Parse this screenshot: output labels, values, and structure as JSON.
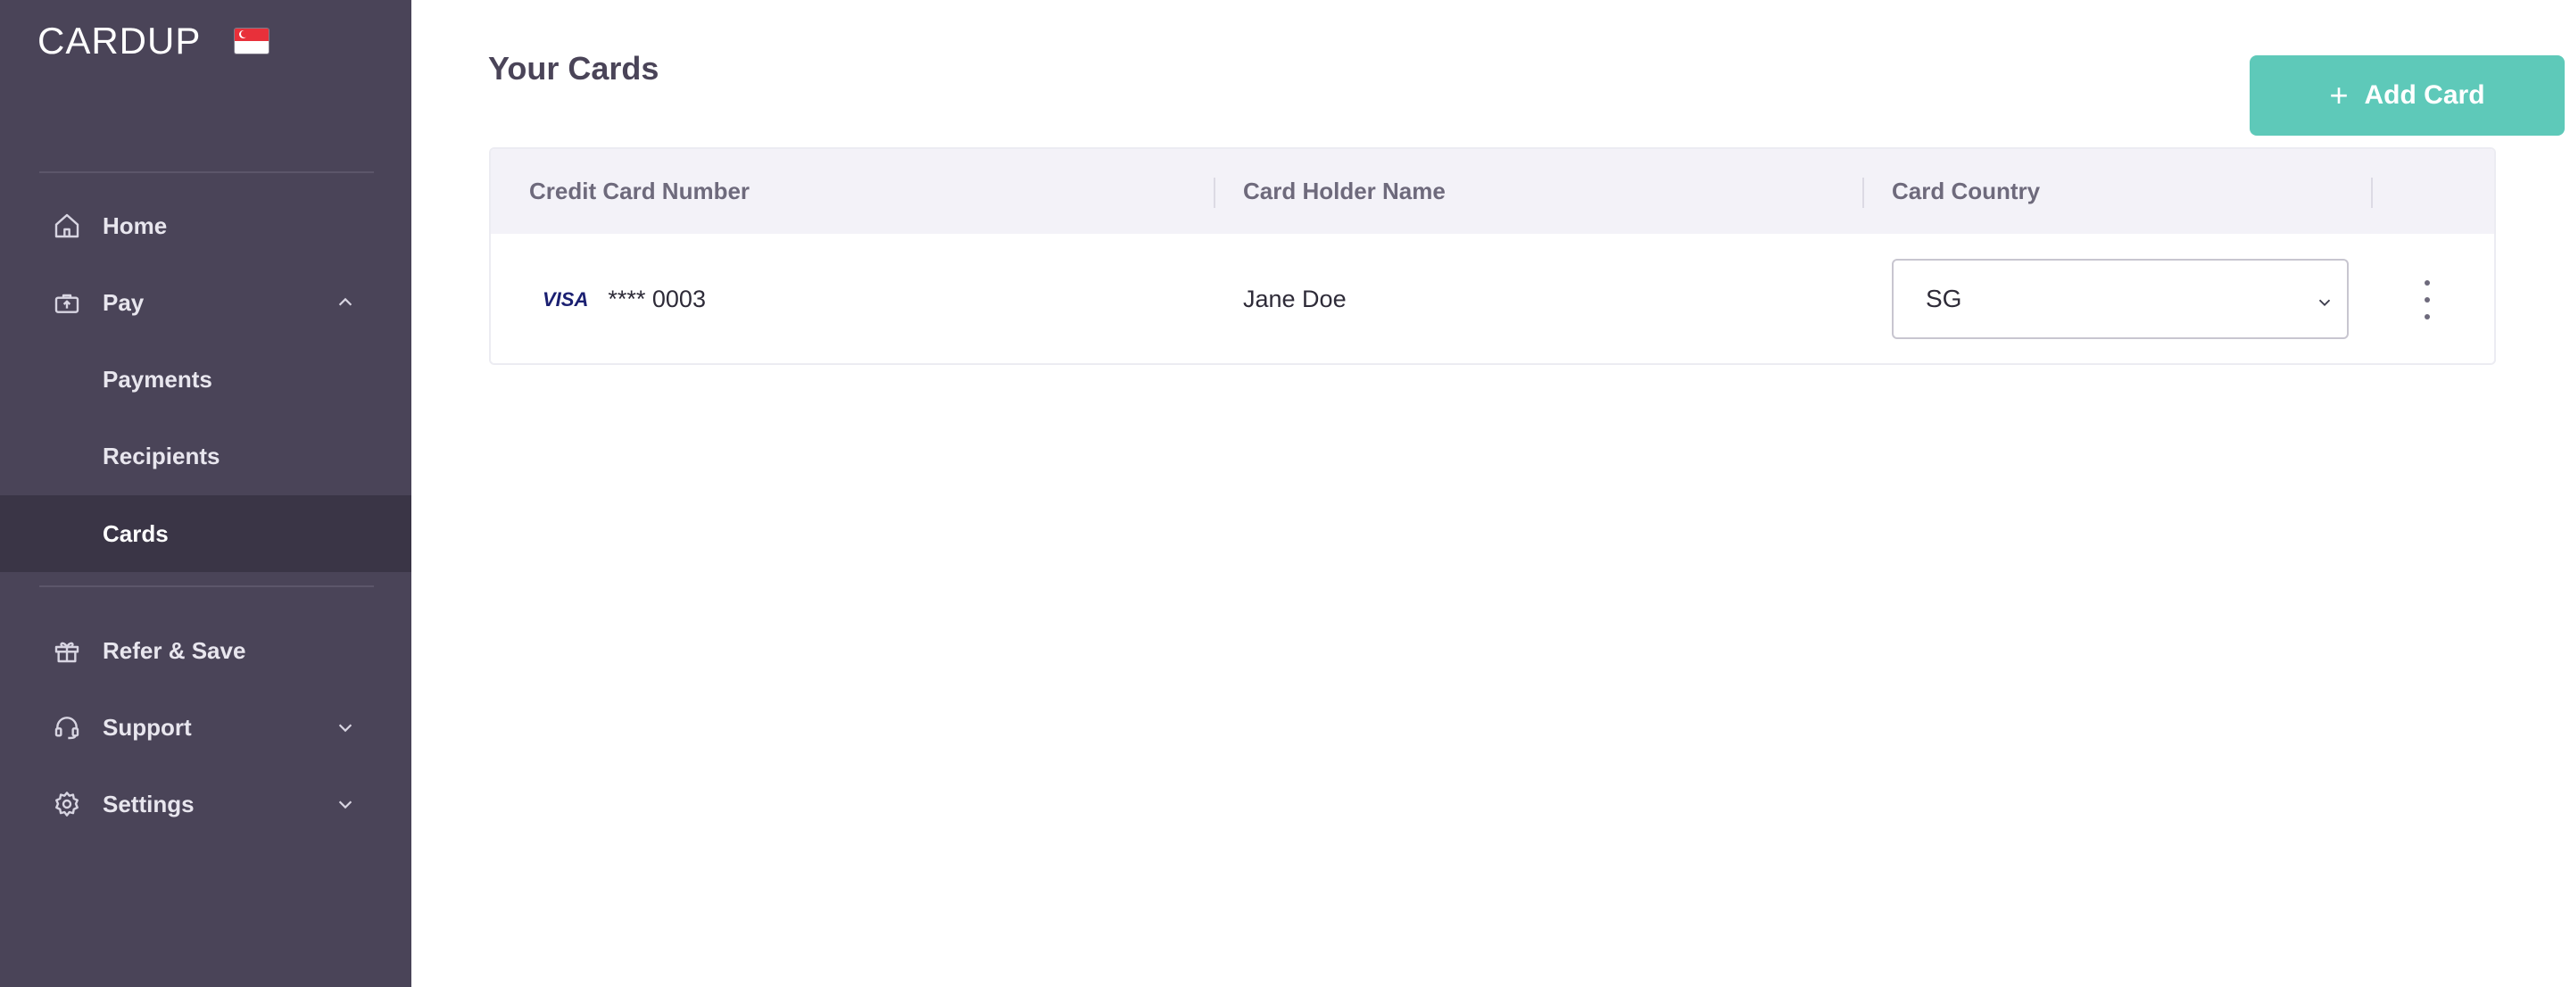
{
  "brand": {
    "logo_text": "CARDUP",
    "flag_icon": "singapore-flag-icon"
  },
  "sidebar": {
    "items": [
      {
        "label": "Home",
        "icon": "home-icon"
      },
      {
        "label": "Pay",
        "icon": "pay-icon",
        "expanded": true
      },
      {
        "label": "Payments"
      },
      {
        "label": "Recipients"
      },
      {
        "label": "Cards",
        "active": true
      },
      {
        "label": "Refer & Save",
        "icon": "gift-icon"
      },
      {
        "label": "Support",
        "icon": "headset-icon",
        "expanded": false
      },
      {
        "label": "Settings",
        "icon": "gear-icon",
        "expanded": false
      }
    ]
  },
  "main": {
    "title": "Your Cards",
    "add_button_label": "Add Card",
    "table": {
      "columns": [
        "Credit Card Number",
        "Card Holder Name",
        "Card Country"
      ],
      "rows": [
        {
          "brand": "VISA",
          "card_number": "**** 0003",
          "holder": "Jane Doe",
          "country": "SG"
        }
      ]
    }
  },
  "colors": {
    "sidebar_bg": "#4a4458",
    "sidebar_active_bg": "#3a3546",
    "accent": "#5ec9b9",
    "table_header_bg": "#f3f2f8"
  }
}
